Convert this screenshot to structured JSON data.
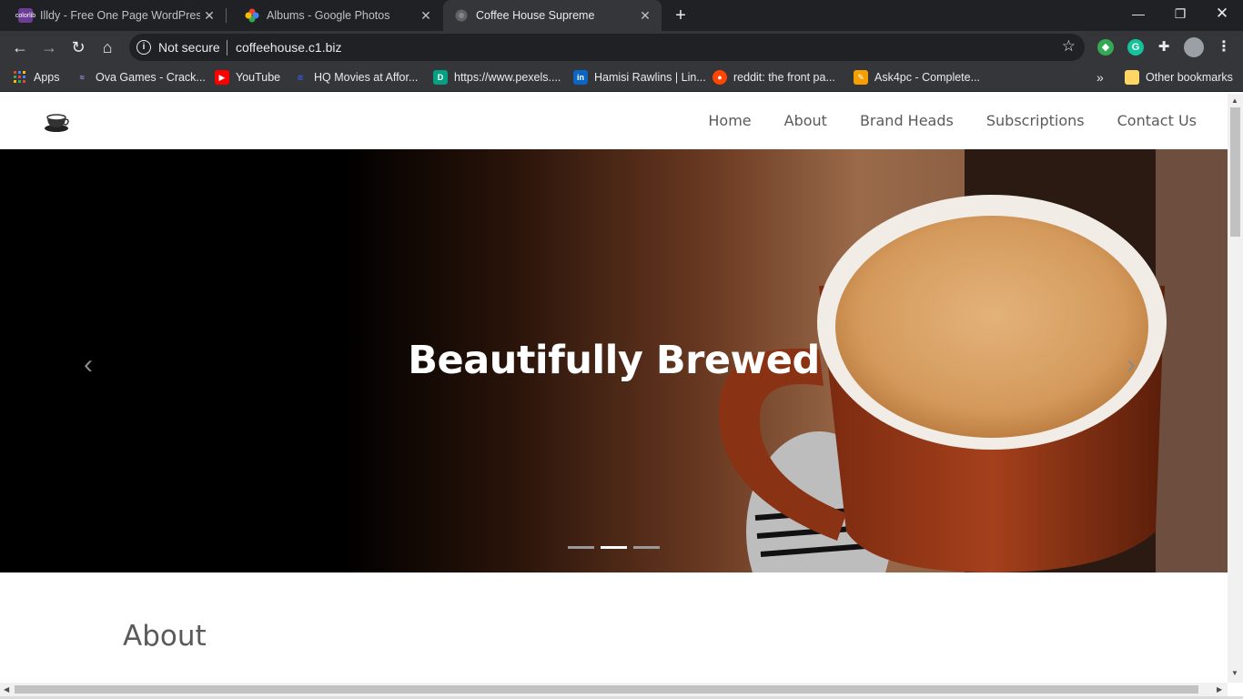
{
  "browser": {
    "tabs": [
      {
        "title": "Illdy - Free One Page WordPress",
        "favicon": "colorlib-icon"
      },
      {
        "title": "Albums - Google Photos",
        "favicon": "google-photos-icon"
      },
      {
        "title": "Coffee House Supreme",
        "favicon": "globe-icon",
        "active": true
      }
    ],
    "omnibox": {
      "security_label": "Not secure",
      "url": "coffeehouse.c1.biz"
    },
    "bookmarks": [
      {
        "label": "Apps"
      },
      {
        "label": "Ova Games - Crack..."
      },
      {
        "label": "YouTube"
      },
      {
        "label": "HQ Movies at Affor..."
      },
      {
        "label": "https://www.pexels...."
      },
      {
        "label": "Hamisi Rawlins | Lin..."
      },
      {
        "label": "reddit: the front pa..."
      },
      {
        "label": "Ask4pc - Complete..."
      }
    ],
    "other_bookmarks": "Other bookmarks",
    "extensions": [
      "colorful-extension-icon",
      "grammarly-icon",
      "puzzle-icon",
      "profile-avatar"
    ],
    "favicon_text": {
      "colorlib": "colorlib",
      "linkedin": "in",
      "pexels": "D",
      "extension": "G"
    }
  },
  "site": {
    "nav": [
      "Home",
      "About",
      "Brand Heads",
      "Subscriptions",
      "Contact Us"
    ],
    "hero": {
      "title": "Beautifully Brewed",
      "active_slide_index": 1,
      "slide_count": 3
    },
    "about_heading": "About"
  },
  "colors": {
    "tab_strip": "#202124",
    "toolbar": "#35363a",
    "nav_text": "#5a5a5a",
    "hero_text": "#ffffff"
  }
}
